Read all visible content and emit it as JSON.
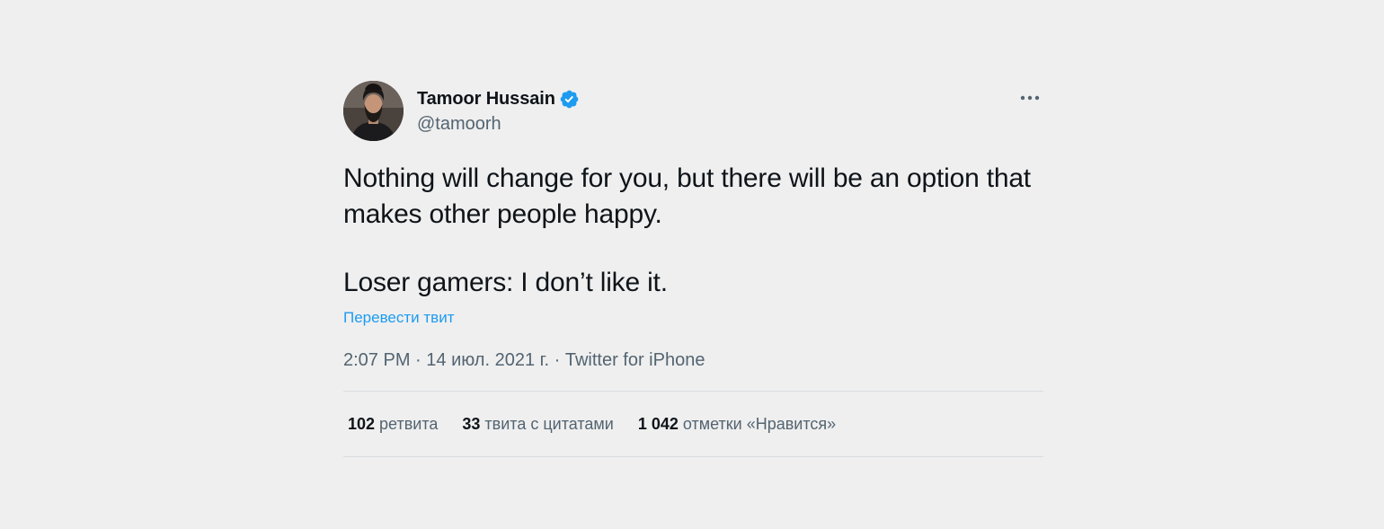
{
  "user": {
    "display_name": "Tamoor Hussain",
    "handle": "@tamoorh",
    "verified": true,
    "verified_icon": "verified-badge-icon",
    "avatar": "profile-photo"
  },
  "more_icon": "ellipsis-icon",
  "tweet": {
    "paragraphs": [
      "Nothing will change for you, but there will be an option that makes other people happy.",
      "Loser gamers: I don’t like it."
    ],
    "translate_label": "Перевести твит"
  },
  "meta": {
    "time": "2:07 PM",
    "separator": " · ",
    "date": "14 июл. 2021 г.",
    "source": "Twitter for iPhone"
  },
  "stats": {
    "retweets": {
      "count": "102",
      "label": "ретвита"
    },
    "quotes": {
      "count": "33",
      "label": "твита с цитатами"
    },
    "likes": {
      "count": "1 042",
      "label": "отметки «Нравится»"
    }
  },
  "colors": {
    "background": "#efefef",
    "text_primary": "#0f1419",
    "text_secondary": "#536471",
    "link": "#1d9bf0",
    "verified": "#1d9bf0",
    "divider": "#d9dddf"
  }
}
